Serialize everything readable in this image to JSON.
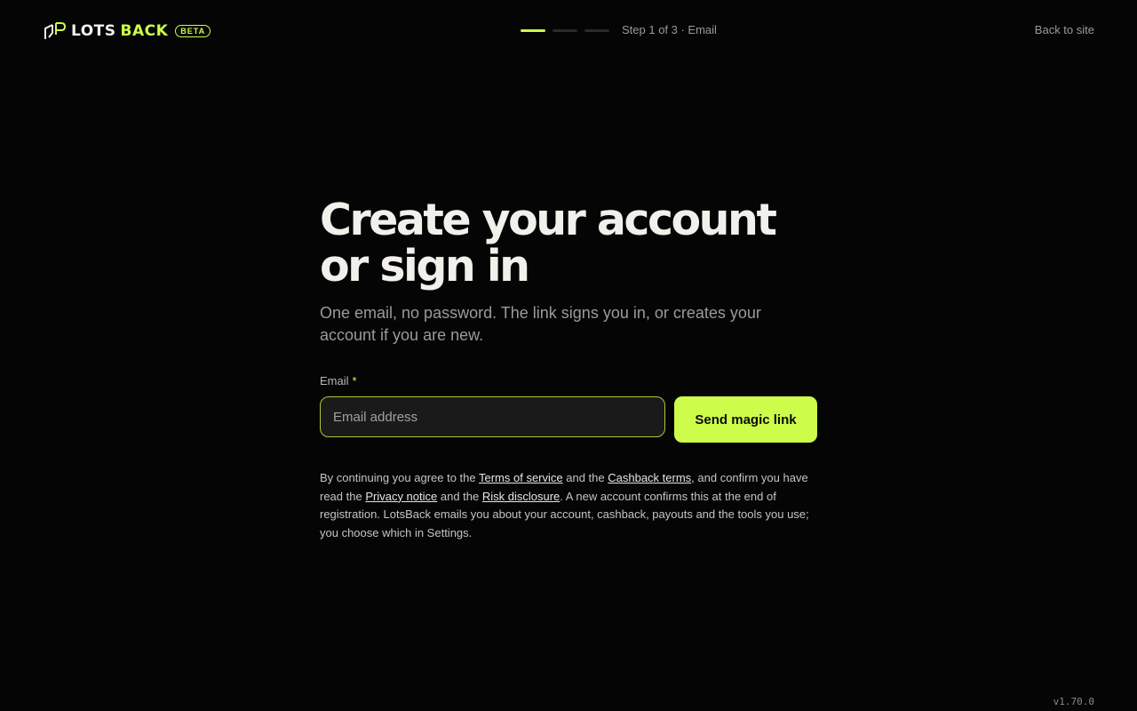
{
  "brand": {
    "name_part1": "LOTS",
    "name_part2": "BACK",
    "badge": "BETA",
    "logo_icon": "lotsback-logo-mark",
    "accent_color": "#cdfc4a"
  },
  "progress": {
    "current_step": 1,
    "total_steps": 3,
    "label": "Step 1 of 3 · Email"
  },
  "header": {
    "back_link": "Back to site"
  },
  "main": {
    "title": "Create your account or sign in",
    "subtitle": "One email, no password. The link signs you in, or creates your account if you are new.",
    "email_label": "Email",
    "required_marker": "*",
    "email_placeholder": "Email address",
    "email_value": "",
    "submit_label": "Send magic link"
  },
  "legal": {
    "t1": "By continuing you agree to the ",
    "terms": "Terms of service",
    "t2": " and the ",
    "cashback": "Cashback terms",
    "t3": ", and confirm you have read the ",
    "privacy": "Privacy notice",
    "t4": " and the ",
    "risk": "Risk disclosure",
    "t5": ". A new account confirms this at the end of registration. LotsBack emails you about your account, cashback, payouts and the tools you use; you choose which in Settings."
  },
  "footer": {
    "version": "v1.70.0"
  }
}
